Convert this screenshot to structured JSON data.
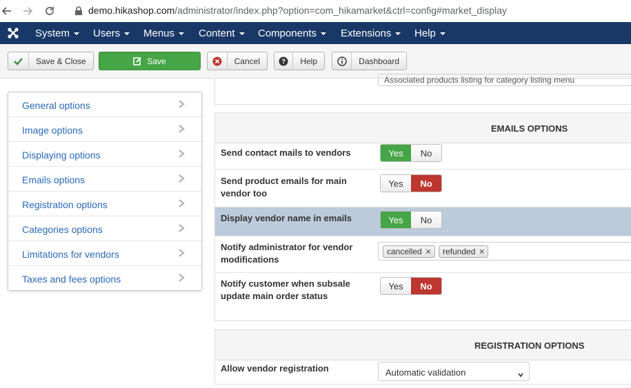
{
  "browser": {
    "url_host": "demo.hikashop.com",
    "url_path": "/administrator/index.php?option=com_hikamarket&ctrl=config#market_display"
  },
  "menu": {
    "items": [
      "System",
      "Users",
      "Menus",
      "Content",
      "Components",
      "Extensions",
      "Help"
    ]
  },
  "toolbar": {
    "save_close": "Save & Close",
    "save": "Save",
    "cancel": "Cancel",
    "help": "Help",
    "dashboard": "Dashboard"
  },
  "sidebar": {
    "items": [
      {
        "label": "General options"
      },
      {
        "label": "Image options"
      },
      {
        "label": "Displaying options"
      },
      {
        "label": "Emails options"
      },
      {
        "label": "Registration options"
      },
      {
        "label": "Categories options"
      },
      {
        "label": "Limitations for vendors"
      },
      {
        "label": "Taxes and fees options"
      }
    ]
  },
  "top_panel": {
    "cut_value": "Associated products listing for category listing menu"
  },
  "emails": {
    "title": "EMAILS OPTIONS",
    "rows": [
      {
        "label": "Send contact mails to vendors",
        "value": "Yes"
      },
      {
        "label": "Send product emails for main vendor too",
        "value": "No"
      },
      {
        "label": "Display vendor name in emails",
        "value": "Yes"
      },
      {
        "label": "Notify administrator for vendor modifications",
        "tags": [
          "cancelled",
          "refunded"
        ]
      },
      {
        "label": "Notify customer when subsale update main order status",
        "value": "No"
      }
    ],
    "yes": "Yes",
    "no": "No"
  },
  "registration": {
    "title": "REGISTRATION OPTIONS",
    "rows": [
      {
        "label": "Allow vendor registration",
        "value": "Automatic validation"
      }
    ]
  },
  "colors": {
    "menubar": "#1a3867",
    "save_green": "#46a546",
    "no_red": "#bd362f",
    "link_blue": "#2a69b8",
    "highlight_row": "#bccbdb"
  }
}
